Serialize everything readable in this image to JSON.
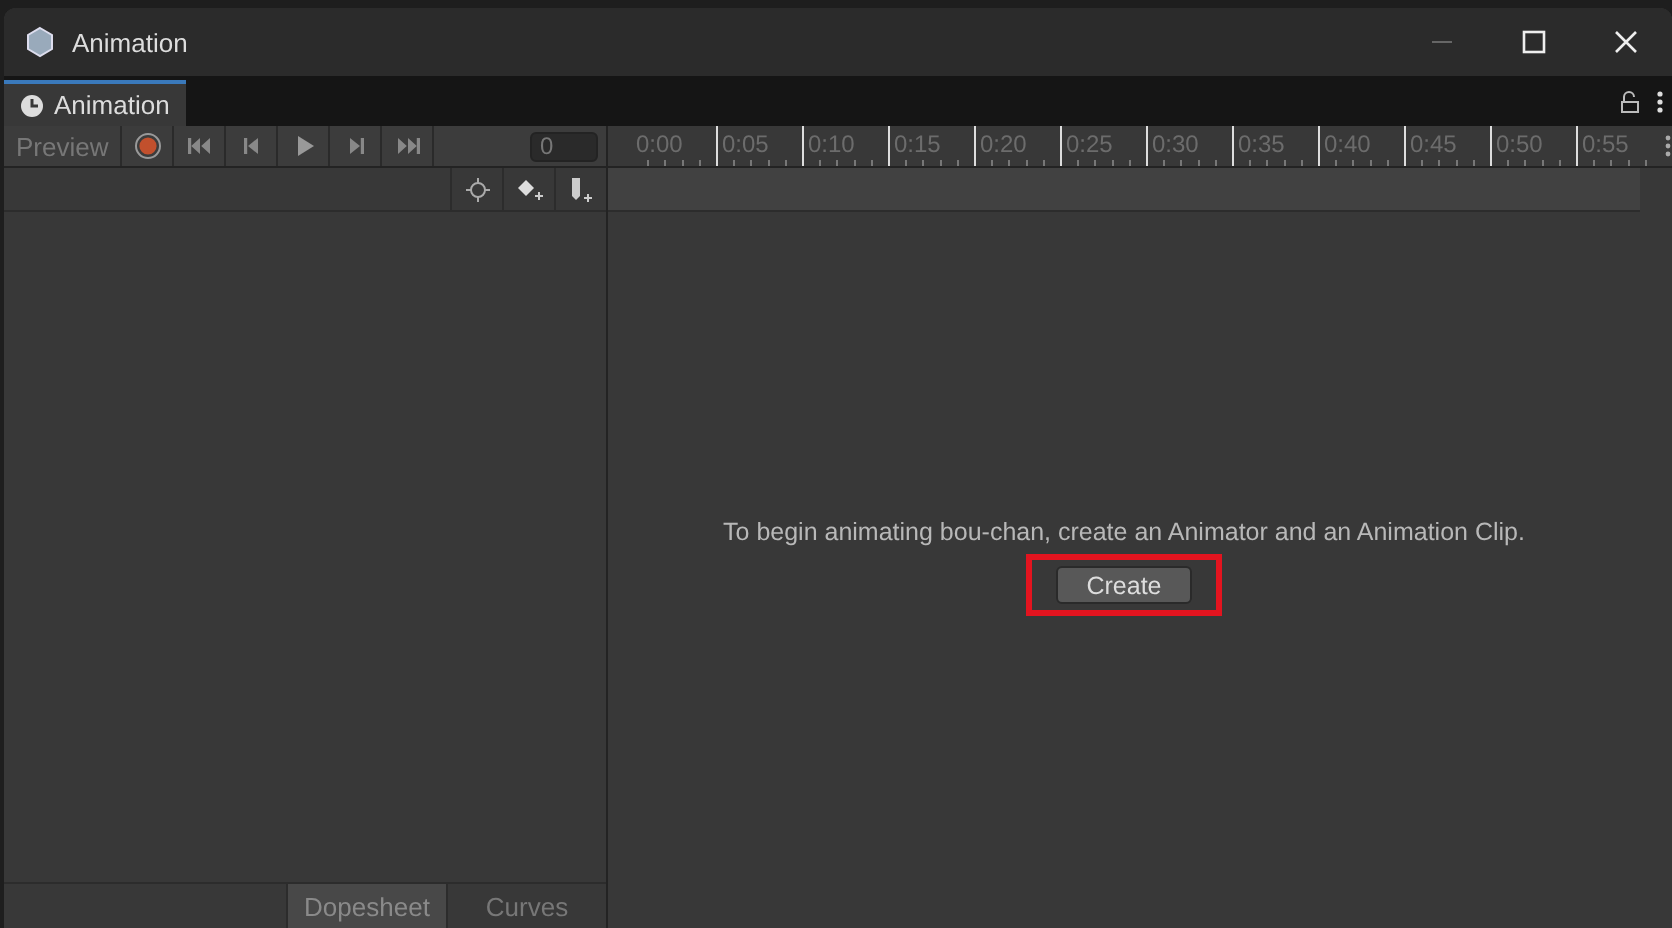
{
  "window": {
    "title": "Animation"
  },
  "tabs": [
    {
      "label": "Animation",
      "selected": true
    }
  ],
  "toolbar": {
    "preview": {
      "label": "Preview",
      "on": false
    },
    "frame": {
      "value": "0"
    }
  },
  "timeline": {
    "ticks": [
      "0:00",
      "0:05",
      "0:10",
      "0:15",
      "0:20",
      "0:25",
      "0:30",
      "0:35",
      "0:40",
      "0:45",
      "0:50",
      "0:55"
    ]
  },
  "message": "To begin animating bou-chan, create an Animator and an Animation Clip.",
  "create_button": {
    "label": "Create",
    "highlighted": true
  },
  "view_tabs": [
    {
      "label": "Dopesheet",
      "selected": true
    },
    {
      "label": "Curves",
      "selected": false
    }
  ]
}
